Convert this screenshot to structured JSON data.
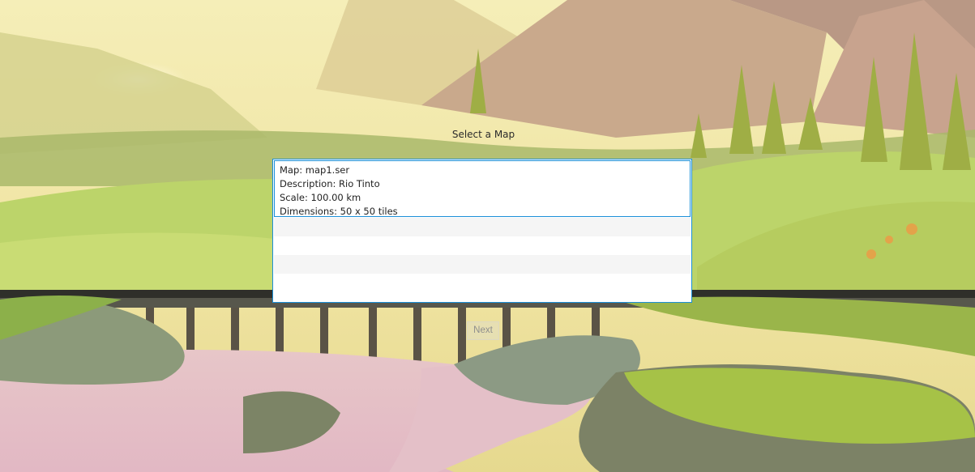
{
  "screen": {
    "title": "Select a Map"
  },
  "map_list": {
    "selected": {
      "map": "Map: map1.ser",
      "description": "Description: Rio Tinto",
      "scale": "Scale: 100.00 km",
      "dimensions": "Dimensions: 50 x 50 tiles"
    }
  },
  "buttons": {
    "next_label": "Next"
  },
  "colors": {
    "selection_border": "#1a8fd8",
    "sky": "#f2e7a8",
    "meadow": "#bcd46a",
    "river": "#e9c3c8"
  }
}
